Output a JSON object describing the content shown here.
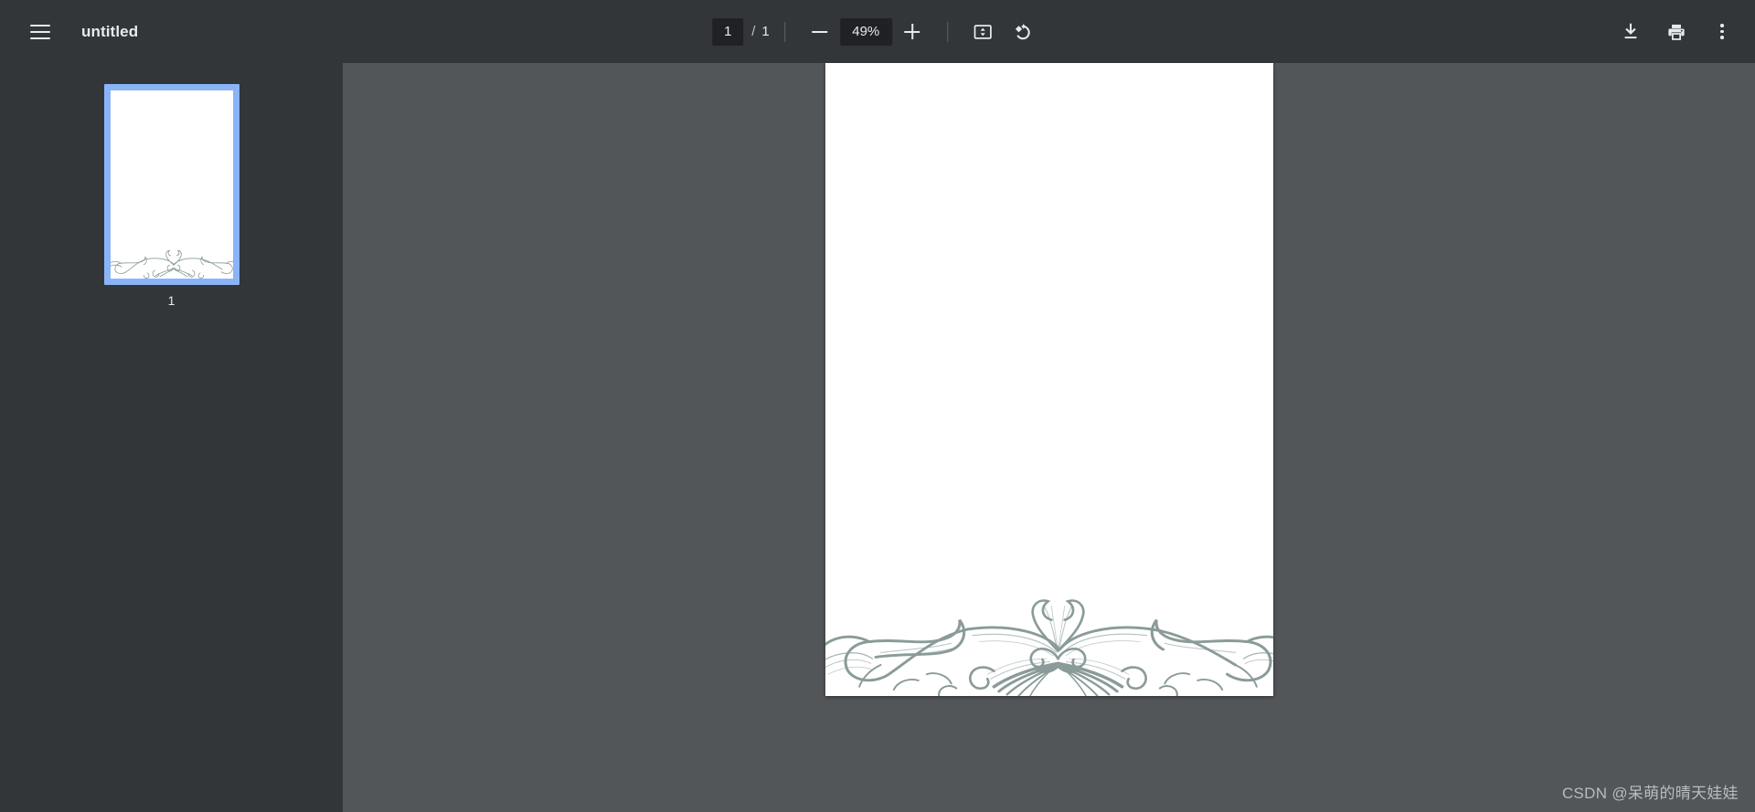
{
  "toolbar": {
    "menu_icon": "hamburger-menu-icon",
    "document_title": "untitled",
    "page_current": "1",
    "page_separator": "/",
    "page_total": "1",
    "zoom_out_icon": "minus-icon",
    "zoom_level": "49%",
    "zoom_in_icon": "plus-icon",
    "fit_page_icon": "fit-to-page-icon",
    "rotate_icon": "rotate-counterclockwise-icon",
    "download_icon": "download-icon",
    "print_icon": "print-icon",
    "more_icon": "more-options-kebab-icon"
  },
  "sidebar": {
    "thumbnails": [
      {
        "label": "1",
        "selected": true
      }
    ]
  },
  "document": {
    "page_number": 1,
    "background": "#ffffff",
    "ornament_name": "floral-flourish-ornament",
    "ornament_color": "#8a9b99",
    "ornament_position": "bottom"
  },
  "colors": {
    "toolbar_bg": "#323639",
    "sidebar_bg": "#323639",
    "viewer_bg": "#525659",
    "field_bg": "#202124",
    "icon": "#e8eaed",
    "selection_blue": "#8ab4f8",
    "ornament": "#8a9b99"
  },
  "watermark": {
    "text": "CSDN @呆萌的晴天娃娃"
  }
}
